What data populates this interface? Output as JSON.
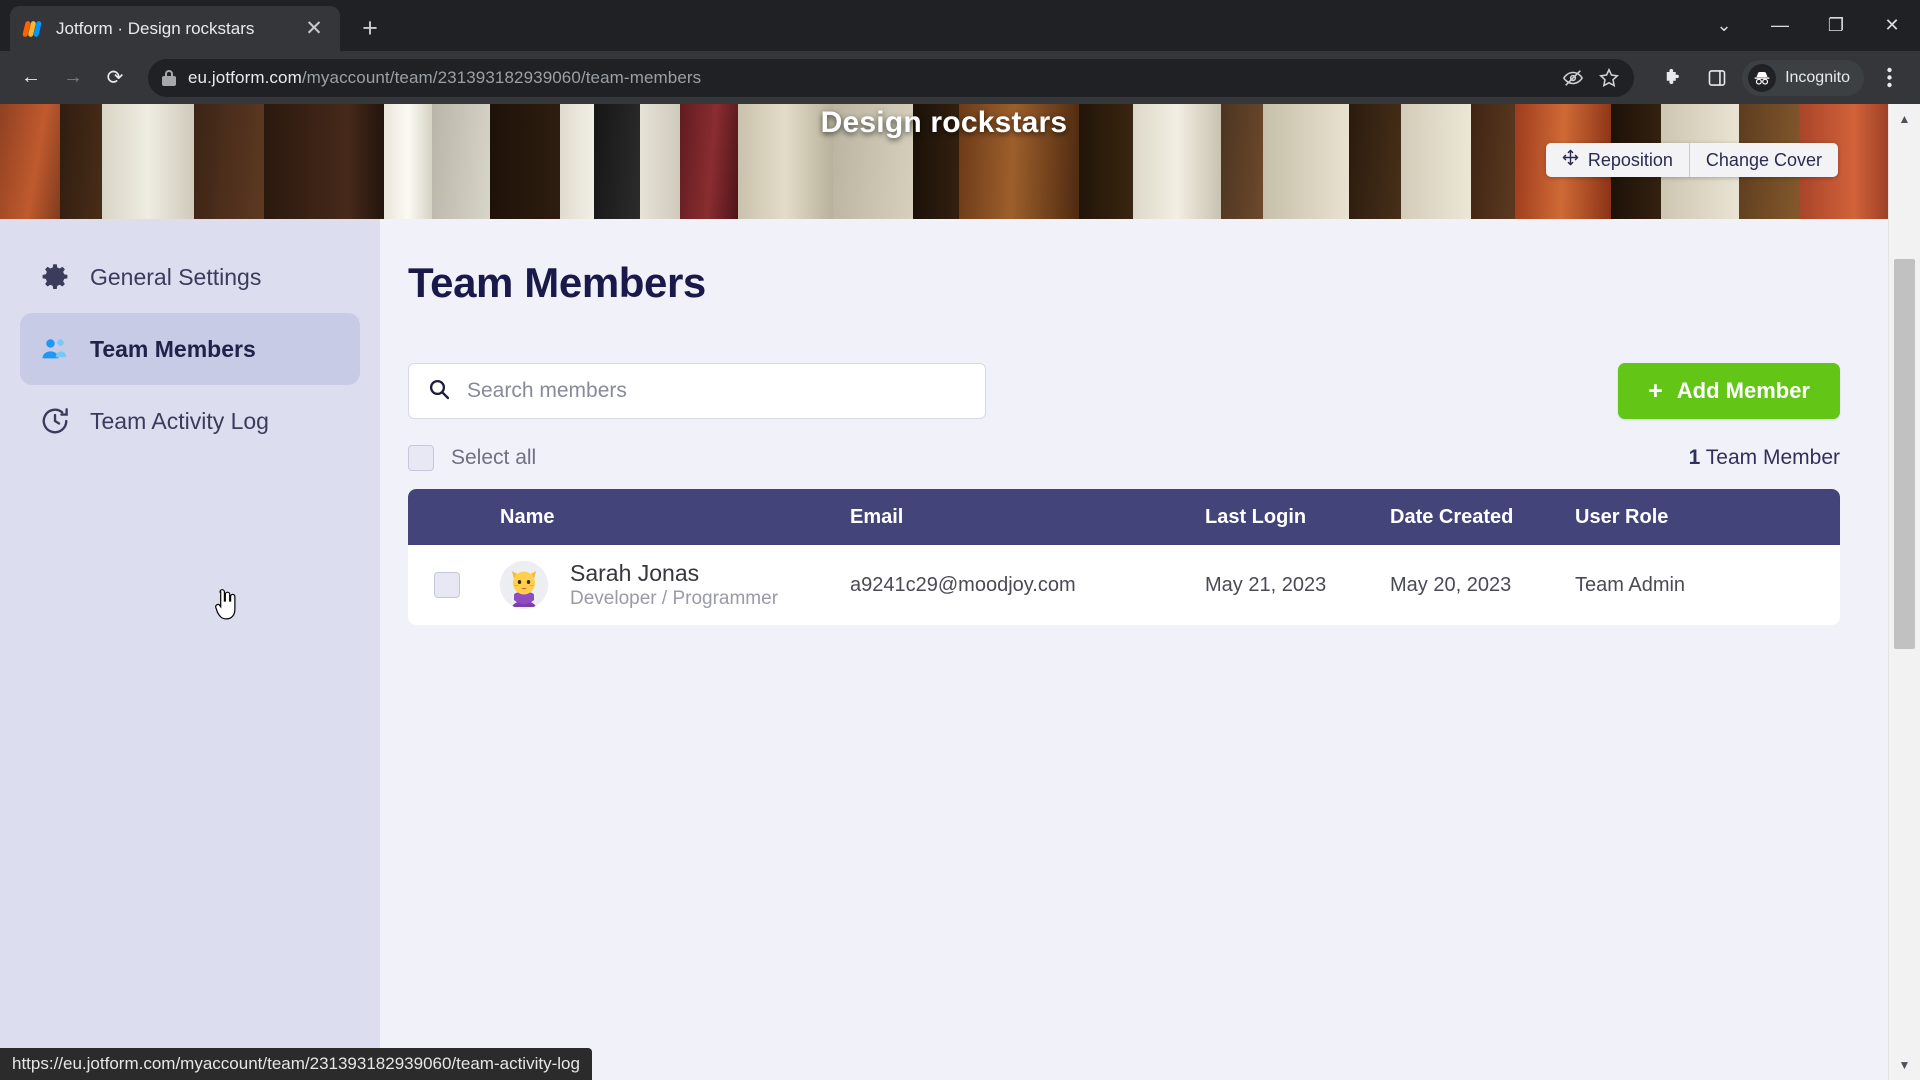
{
  "browser": {
    "tab": {
      "title": "Jotform · Design rockstars",
      "favicon_name": "jotform-logo",
      "close_label": "✕"
    },
    "new_tab_label": "+",
    "window_controls": {
      "minimize_group": "⌄",
      "minimize": "—",
      "maximize": "❐",
      "close": "✕"
    },
    "nav": {
      "back": "←",
      "forward": "→",
      "reload": "⟳"
    },
    "address": {
      "domain": "eu.jotform.com",
      "path": "/myaccount/team/231393182939060/team-members",
      "lock_icon": "lock-icon"
    },
    "omnibox_actions": {
      "hide_icon": "eye-slash-icon",
      "bookmark_icon": "star-icon"
    },
    "toolbar_right": {
      "extensions_icon": "puzzle-piece-icon",
      "side_panel_icon": "side-panel-icon"
    },
    "profile": {
      "label": "Incognito",
      "icon": "incognito-hat-icon"
    },
    "menu_icon": "three-dot-menu-icon",
    "status_bar_url": "https://eu.jotform.com/myaccount/team/231393182939060/team-activity-log"
  },
  "cover": {
    "title": "Design rockstars",
    "reposition_label": "Reposition",
    "reposition_icon": "move-arrows-icon",
    "change_cover_label": "Change Cover"
  },
  "sidebar": {
    "items": [
      {
        "label": "General Settings",
        "icon": "gear-icon",
        "active": false
      },
      {
        "label": "Team Members",
        "icon": "people-icon",
        "active": true
      },
      {
        "label": "Team Activity Log",
        "icon": "clock-history-icon",
        "active": false
      }
    ]
  },
  "main": {
    "page_title": "Team Members",
    "search": {
      "placeholder": "Search members",
      "value": "",
      "icon": "search-icon"
    },
    "add_member": {
      "label": "Add Member",
      "plus": "+"
    },
    "select_all_label": "Select all",
    "count_number": "1",
    "count_label": " Team Member",
    "table": {
      "headers": [
        "Name",
        "Email",
        "Last Login",
        "Date Created",
        "User Role"
      ],
      "rows": [
        {
          "name": "Sarah Jonas",
          "role_title": "Developer / Programmer",
          "email": "a9241c29@moodjoy.com",
          "last_login": "May 21, 2023",
          "date_created": "May 20, 2023",
          "user_role": "Team Admin",
          "avatar_icon": "avatar-cat-character"
        }
      ]
    }
  },
  "colors": {
    "accent_green": "#63c617",
    "table_header": "#42447a",
    "sidebar_bg": "#dcdef0",
    "page_bg": "#f1f1fa",
    "title_navy": "#19194a"
  }
}
